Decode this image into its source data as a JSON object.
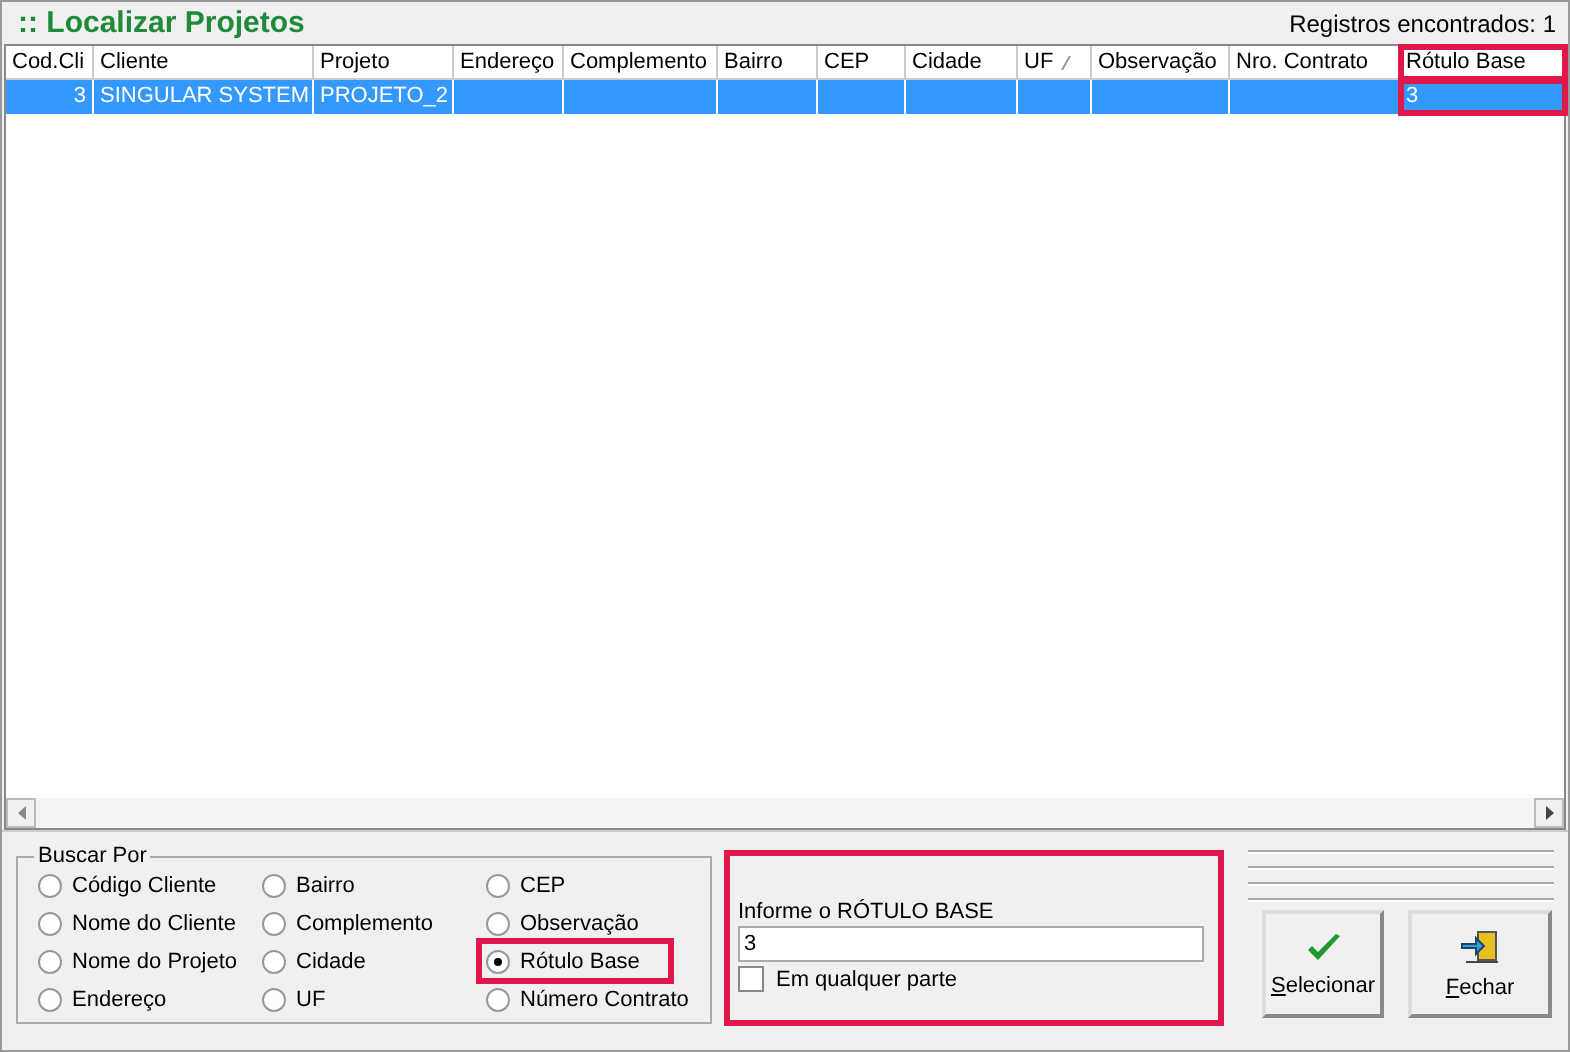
{
  "title": ":: Localizar Projetos",
  "records": "Registros encontrados: 1",
  "table": {
    "columns": [
      {
        "label": "Cod.Cli",
        "highlighted": false,
        "sort": false
      },
      {
        "label": "Cliente",
        "highlighted": false,
        "sort": false
      },
      {
        "label": "Projeto",
        "highlighted": false,
        "sort": false
      },
      {
        "label": "Endereço",
        "highlighted": false,
        "sort": false
      },
      {
        "label": "Complemento",
        "highlighted": false,
        "sort": false
      },
      {
        "label": "Bairro",
        "highlighted": false,
        "sort": false
      },
      {
        "label": "CEP",
        "highlighted": false,
        "sort": false
      },
      {
        "label": "Cidade",
        "highlighted": false,
        "sort": false
      },
      {
        "label": "UF",
        "highlighted": false,
        "sort": true
      },
      {
        "label": "Observação",
        "highlighted": false,
        "sort": false
      },
      {
        "label": "Nro. Contrato",
        "highlighted": false,
        "sort": false
      },
      {
        "label": "Rótulo Base",
        "highlighted": true,
        "sort": false
      }
    ],
    "rows": [
      {
        "selected": true,
        "cells": [
          "3",
          "SINGULAR SYSTEM",
          "PROJETO_2",
          "",
          "",
          "",
          "",
          "",
          "",
          "",
          "",
          "3"
        ]
      }
    ]
  },
  "search_by": {
    "title": "Buscar Por",
    "options": [
      {
        "label": "Código Cliente",
        "selected": false,
        "highlighted": false
      },
      {
        "label": "Nome do Cliente",
        "selected": false,
        "highlighted": false
      },
      {
        "label": "Nome do Projeto",
        "selected": false,
        "highlighted": false
      },
      {
        "label": "Endereço",
        "selected": false,
        "highlighted": false
      },
      {
        "label": "Bairro",
        "selected": false,
        "highlighted": false
      },
      {
        "label": "Complemento",
        "selected": false,
        "highlighted": false
      },
      {
        "label": "Cidade",
        "selected": false,
        "highlighted": false
      },
      {
        "label": "UF",
        "selected": false,
        "highlighted": false
      },
      {
        "label": "CEP",
        "selected": false,
        "highlighted": false
      },
      {
        "label": "Observação",
        "selected": false,
        "highlighted": false
      },
      {
        "label": "Rótulo Base",
        "selected": true,
        "highlighted": true
      },
      {
        "label": "Número Contrato",
        "selected": false,
        "highlighted": false
      }
    ]
  },
  "input_panel": {
    "highlighted": true,
    "label": "Informe o RÓTULO BASE",
    "value": "3",
    "anywhere": {
      "label": "Em qualquer parte",
      "checked": false
    }
  },
  "buttons": [
    {
      "label": "Selecionar",
      "kind": "check"
    },
    {
      "label": "Fechar",
      "kind": "door"
    }
  ]
}
